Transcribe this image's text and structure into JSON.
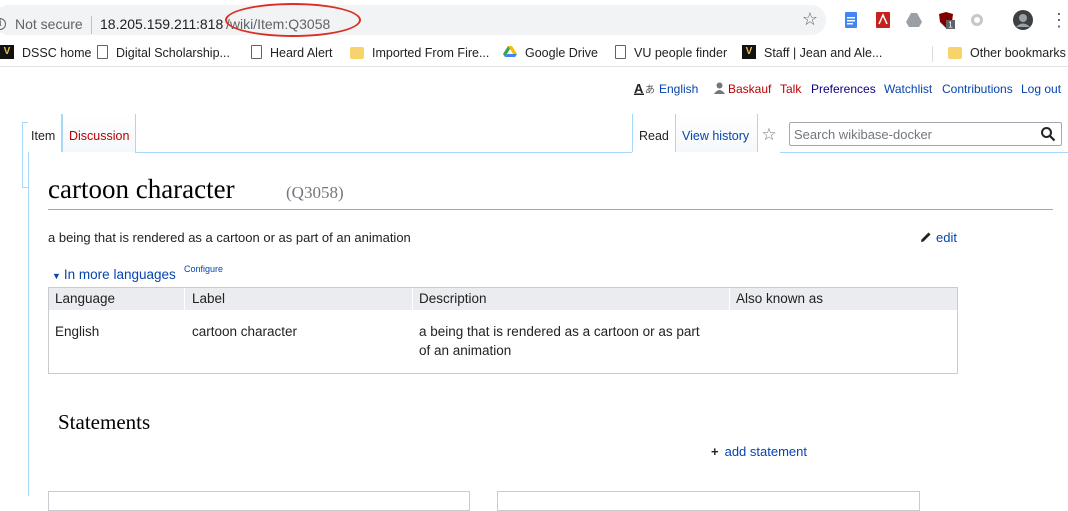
{
  "browser": {
    "not_secure_label": "Not secure",
    "url_host": "18.205.159.211",
    "url_port": ":818",
    "url_path": "/wiki/Item:Q3058",
    "bookmarks": [
      {
        "label": "DSSC home",
        "icon": "vanderbilt-icon"
      },
      {
        "label": "Digital Scholarship...",
        "icon": "page-icon"
      },
      {
        "label": "Heard Alert",
        "icon": "page-icon"
      },
      {
        "label": "Imported From Fire...",
        "icon": "folder-icon"
      },
      {
        "label": "Google Drive",
        "icon": "google-drive-icon"
      },
      {
        "label": "VU people finder",
        "icon": "page-icon"
      },
      {
        "label": "Staff | Jean and Ale...",
        "icon": "vanderbilt-icon"
      }
    ],
    "other_bookmarks": "Other bookmarks",
    "ext_badge": "1"
  },
  "personal": {
    "language": "English",
    "username": "Baskauf",
    "talk": "Talk",
    "preferences": "Preferences",
    "watchlist": "Watchlist",
    "contributions": "Contributions",
    "logout": "Log out"
  },
  "tabs": {
    "item": "Item",
    "discussion": "Discussion",
    "read": "Read",
    "view_history": "View history"
  },
  "search": {
    "placeholder": "Search wikibase-docker"
  },
  "item": {
    "label": "cartoon character",
    "id": "(Q3058)",
    "description": "a being that is rendered as a cartoon or as part of an animation",
    "edit": "edit"
  },
  "languages": {
    "toggle": "In more languages",
    "configure": "Configure",
    "headers": [
      "Language",
      "Label",
      "Description",
      "Also known as"
    ],
    "rows": [
      {
        "language": "English",
        "label": "cartoon character",
        "description_line1": "a being that is rendered as a cartoon or as part",
        "description_line2": "of an animation",
        "aliases": ""
      }
    ]
  },
  "statements": {
    "heading": "Statements",
    "add": "add statement"
  }
}
